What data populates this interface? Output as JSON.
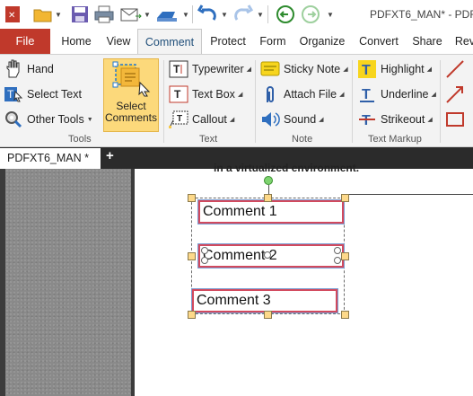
{
  "window": {
    "title": "PDFXT6_MAN* - PDF"
  },
  "quick_access": {
    "icons": [
      "folder-open-icon",
      "save-icon",
      "print-icon",
      "email-icon",
      "scan-icon",
      "undo-icon",
      "redo-icon",
      "back-icon",
      "forward-icon"
    ]
  },
  "tabs": {
    "file": "File",
    "items": [
      "Home",
      "View",
      "Comment",
      "Protect",
      "Form",
      "Organize",
      "Convert",
      "Share",
      "Rev"
    ],
    "active": "Comment"
  },
  "ribbon": {
    "tools": {
      "hand": "Hand",
      "select_text": "Select Text",
      "other_tools": "Other Tools",
      "label": "Tools"
    },
    "select_comments": {
      "line1": "Select",
      "line2": "Comments"
    },
    "text": {
      "typewriter": "Typewriter",
      "text_box": "Text Box",
      "callout": "Callout",
      "label": "Text"
    },
    "note": {
      "sticky_note": "Sticky Note",
      "attach_file": "Attach File",
      "sound": "Sound",
      "label": "Note"
    },
    "markup": {
      "highlight": "Highlight",
      "underline": "Underline",
      "strikeout": "Strikeout",
      "label": "Text Markup"
    }
  },
  "doc_tab": {
    "name": "PDFXT6_MAN *",
    "add": "+"
  },
  "document": {
    "fragment": "in a virtualized environment.",
    "comments": [
      "Comment 1",
      "Comment 2",
      "Comment 3"
    ]
  },
  "colors": {
    "file_tab": "#c0392b",
    "selected_button": "#fcd97b",
    "comment_border": "#d24a5e"
  }
}
